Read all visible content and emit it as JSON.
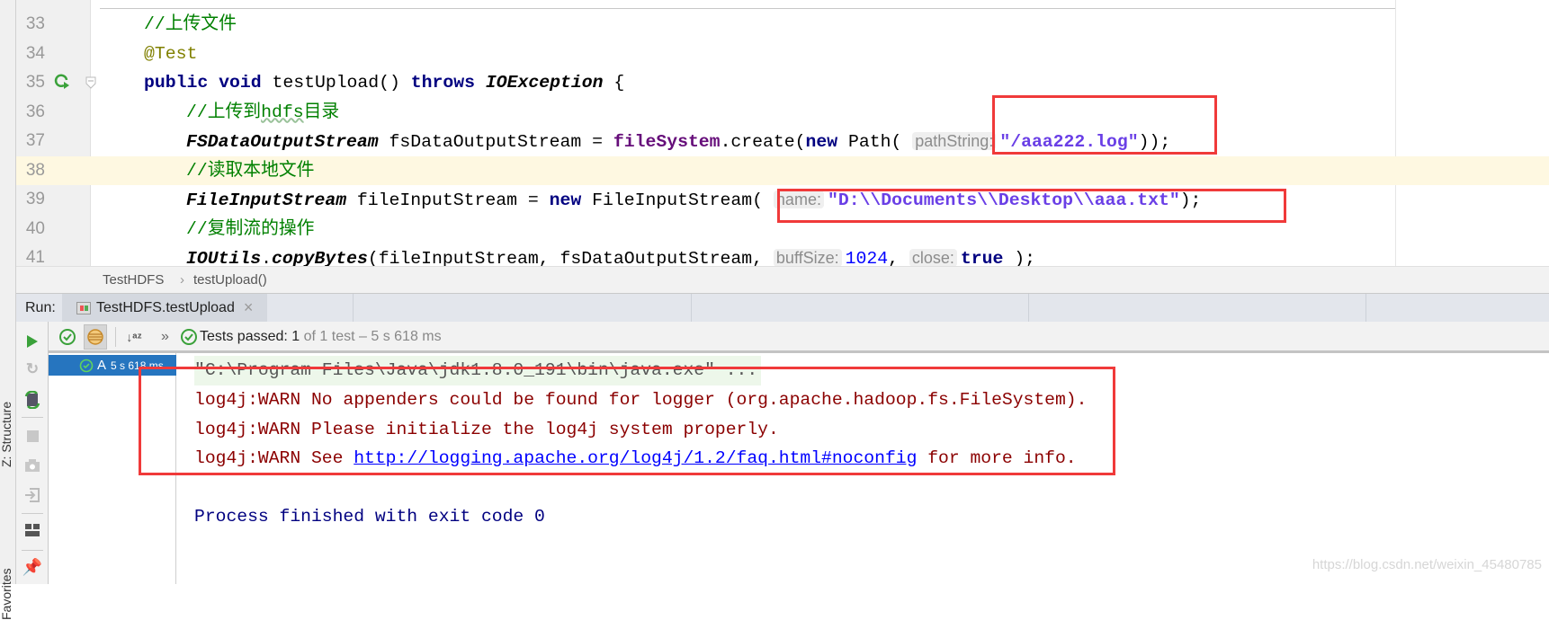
{
  "side_labels": {
    "structure": "Z: Structure",
    "favorites": "Favorites"
  },
  "editor": {
    "current_line": 38,
    "lines": [
      {
        "num": "33",
        "indent": 1,
        "tokens": [
          {
            "t": "//上传文件",
            "c": "cm"
          }
        ]
      },
      {
        "num": "34",
        "indent": 1,
        "tokens": [
          {
            "t": "@Test",
            "c": "an"
          }
        ]
      },
      {
        "num": "35",
        "indent": 1,
        "tokens": [
          {
            "t": "public",
            "c": "kw"
          },
          {
            "t": " "
          },
          {
            "t": "void",
            "c": "kw"
          },
          {
            "t": " testUpload() "
          },
          {
            "t": "throws",
            "c": "kw"
          },
          {
            "t": " "
          },
          {
            "t": "IOException",
            "c": "ty"
          },
          {
            "t": " {"
          }
        ]
      },
      {
        "num": "36",
        "indent": 2,
        "tokens": [
          {
            "t": "//上传到",
            "c": "cm"
          },
          {
            "t": "hdfs",
            "c": "cm ul"
          },
          {
            "t": "目录",
            "c": "cm"
          }
        ]
      },
      {
        "num": "37",
        "indent": 2,
        "tokens": [
          {
            "t": "FSDataOutputStream",
            "c": "ty"
          },
          {
            "t": " fsDataOutputStream = "
          },
          {
            "t": "fileSystem",
            "c": "fd"
          },
          {
            "t": ".create("
          },
          {
            "t": "new",
            "c": "kw"
          },
          {
            "t": " Path( "
          },
          {
            "t": "pathString:",
            "c": "hint"
          },
          {
            "t": "\"/aaa222.log\"",
            "c": "st"
          },
          {
            "t": "));"
          }
        ]
      },
      {
        "num": "38",
        "indent": 2,
        "tokens": [
          {
            "t": "//读取本地文件",
            "c": "cm"
          }
        ]
      },
      {
        "num": "39",
        "indent": 2,
        "tokens": [
          {
            "t": "FileInputStream",
            "c": "ty"
          },
          {
            "t": " fileInputStream = "
          },
          {
            "t": "new",
            "c": "kw"
          },
          {
            "t": " FileInputStream( "
          },
          {
            "t": "name:",
            "c": "hint"
          },
          {
            "t": "\"D:\\\\Documents\\\\Desktop\\\\aaa.txt\"",
            "c": "st"
          },
          {
            "t": ");"
          }
        ]
      },
      {
        "num": "40",
        "indent": 2,
        "tokens": [
          {
            "t": "//复制流的操作",
            "c": "cm"
          }
        ]
      },
      {
        "num": "41",
        "indent": 2,
        "tokens": [
          {
            "t": "IOUtils",
            "c": "ty"
          },
          {
            "t": "."
          },
          {
            "t": "copyBytes",
            "c": "ty"
          },
          {
            "t": "(fileInputStream, fsDataOutputStream, "
          },
          {
            "t": "buffSize:",
            "c": "hint"
          },
          {
            "t": "1024",
            "c": "nm"
          },
          {
            "t": ", "
          },
          {
            "t": "close:",
            "c": "hint"
          },
          {
            "t": "true",
            "c": "kw"
          },
          {
            "t": " );"
          }
        ]
      }
    ]
  },
  "breadcrumb": {
    "class": "TestHDFS",
    "sep": "›",
    "method": "testUpload()"
  },
  "run": {
    "label": "Run:",
    "tab": "TestHDFS.testUpload",
    "tab_close": "×",
    "status_prefix": "Tests passed:",
    "status_count": "1",
    "status_rest": "of 1 test – 5 s 618 ms",
    "more": "»",
    "tree_item": {
      "name": "A",
      "time": "5 s 618 ms"
    }
  },
  "console": {
    "command": "\"C:\\Program Files\\Java\\jdk1.8.0_191\\bin\\java.exe\" ...",
    "warn1": "log4j:WARN No appenders could be found for logger (org.apache.hadoop.fs.FileSystem).",
    "warn2": "log4j:WARN Please initialize the log4j system properly.",
    "warn3_pre": "log4j:WARN See ",
    "warn3_link": "http://logging.apache.org/log4j/1.2/faq.html#noconfig",
    "warn3_post": " for more info.",
    "exit": "Process finished with exit code 0"
  },
  "watermark": "https://blog.csdn.net/weixin_45480785",
  "colors": {
    "highlight_box": "#f03a3a",
    "selection": "#2675bf",
    "pass_green": "#3aa13a"
  }
}
